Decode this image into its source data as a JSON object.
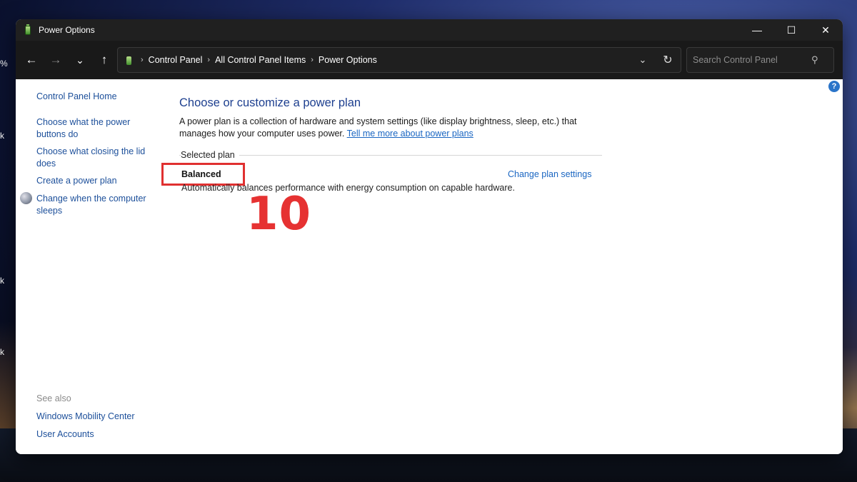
{
  "window": {
    "title": "Power Options",
    "controls": {
      "minimize": "—",
      "maximize": "☐",
      "close": "✕"
    }
  },
  "nav": {
    "back": "←",
    "forward": "→",
    "recent": "⌄",
    "up": "↑",
    "breadcrumbs": [
      "Control Panel",
      "All Control Panel Items",
      "Power Options"
    ],
    "separator": "›",
    "dropdown": "⌄",
    "refresh": "↻",
    "search_placeholder": "Search Control Panel",
    "search_icon": "⚲"
  },
  "sidebar": {
    "home": "Control Panel Home",
    "links": [
      "Choose what the power buttons do",
      "Choose what closing the lid does",
      "Create a power plan",
      "Change when the computer sleeps"
    ],
    "see_also_label": "See also",
    "see_also_links": [
      "Windows Mobility Center",
      "User Accounts"
    ]
  },
  "main": {
    "title": "Choose or customize a power plan",
    "description": "A power plan is a collection of hardware and system settings (like display brightness, sleep, etc.) that manages how your computer uses power.",
    "learn_more_link": "Tell me more about power plans",
    "selected_plan_label": "Selected plan",
    "plan_name": "Balanced",
    "plan_description": "Automatically balances performance with energy consumption on capable hardware.",
    "change_plan_link": "Change plan settings",
    "help": "?"
  },
  "annotation": {
    "step_number": "10",
    "highlight_color": "#e03030"
  },
  "desktop_fragments": [
    "%",
    "k",
    "k",
    "k"
  ]
}
